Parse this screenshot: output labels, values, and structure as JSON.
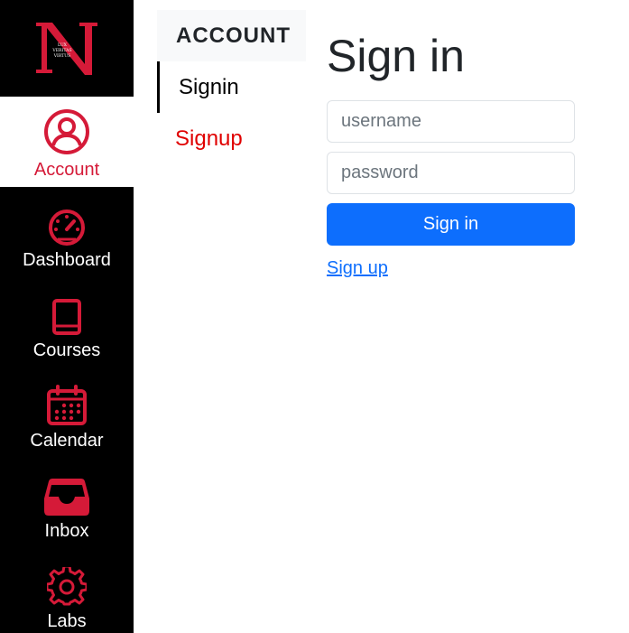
{
  "logo": {
    "letter": "N",
    "motto": [
      "LUX",
      "VERITAS",
      "VIRTUS"
    ],
    "color": "#d51a38"
  },
  "sidebar": {
    "accent_color": "#d51a38",
    "items": [
      {
        "label": "Account",
        "icon": "user-circle-icon",
        "active": true
      },
      {
        "label": "Dashboard",
        "icon": "speedometer-icon",
        "active": false
      },
      {
        "label": "Courses",
        "icon": "book-icon",
        "active": false
      },
      {
        "label": "Calendar",
        "icon": "calendar-icon",
        "active": false
      },
      {
        "label": "Inbox",
        "icon": "inbox-icon",
        "active": false
      },
      {
        "label": "Labs",
        "icon": "gear-icon",
        "active": false
      }
    ]
  },
  "account_nav": {
    "header": "ACCOUNT",
    "links": [
      {
        "label": "Signin",
        "active": true
      },
      {
        "label": "Signup",
        "active": false
      }
    ]
  },
  "signin": {
    "title": "Sign in",
    "username_placeholder": "username",
    "password_placeholder": "password",
    "submit_label": "Sign in",
    "signup_link": "Sign up",
    "button_color": "#0d6efd"
  }
}
